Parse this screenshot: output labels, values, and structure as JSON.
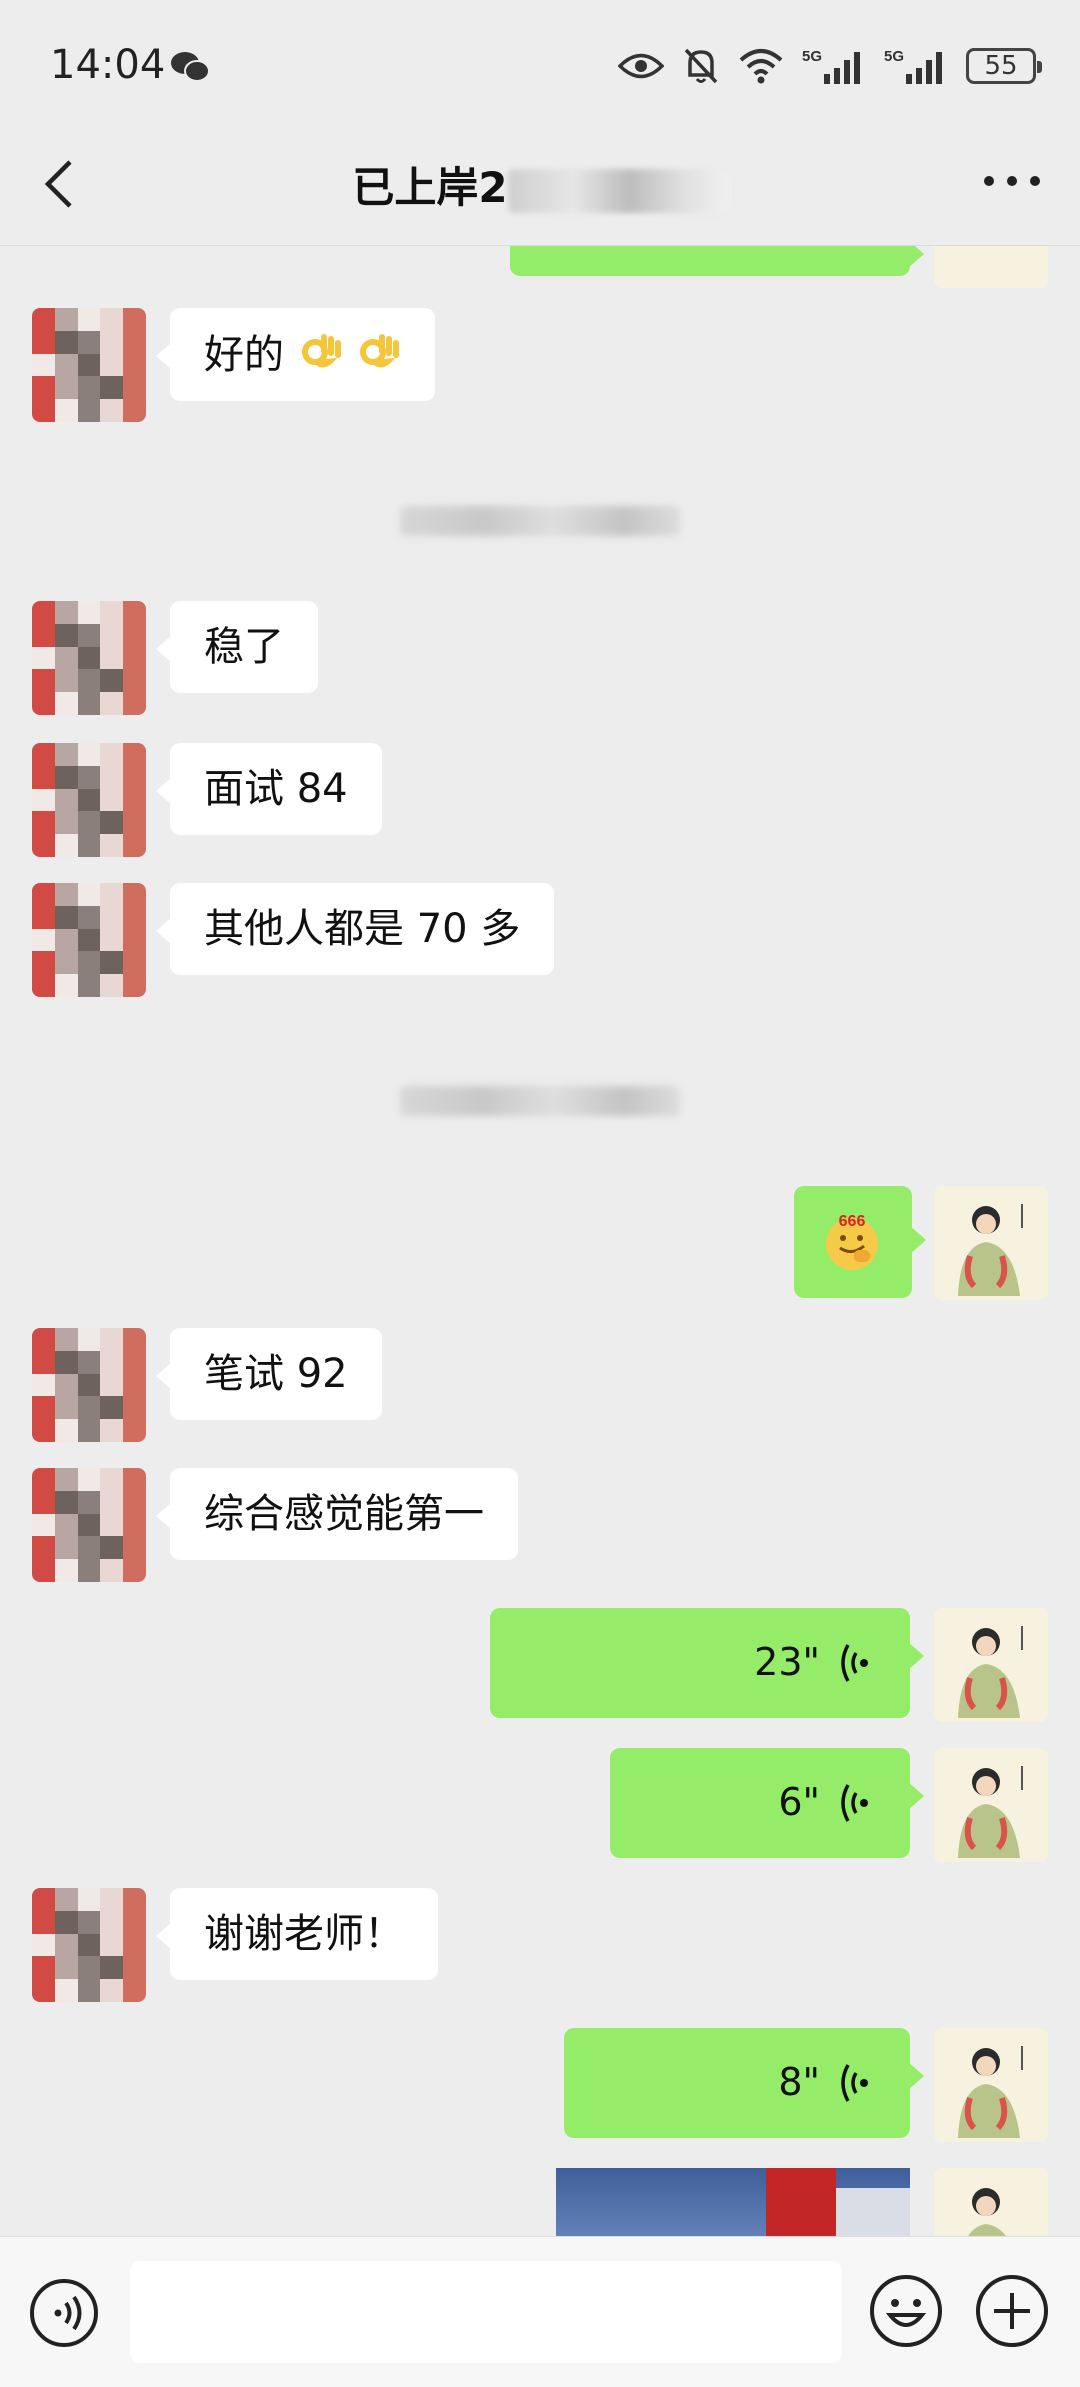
{
  "status_bar": {
    "time": "14:04",
    "battery": "55",
    "network_1": "5G",
    "network_2": "5G"
  },
  "nav": {
    "title": "已上岸2"
  },
  "messages": [
    {
      "side": "in",
      "text": "好的"
    },
    {
      "side": "in",
      "text": "稳了"
    },
    {
      "side": "in",
      "text": "面试 84"
    },
    {
      "side": "in",
      "text": "其他人都是 70 多"
    },
    {
      "side": "out",
      "type": "sticker",
      "text": "666"
    },
    {
      "side": "in",
      "text": "笔试 92"
    },
    {
      "side": "in",
      "text": "综合感觉能第一"
    },
    {
      "side": "out",
      "type": "voice",
      "duration": "23\""
    },
    {
      "side": "out",
      "type": "voice",
      "duration": "6\""
    },
    {
      "side": "in",
      "text": "谢谢老师！"
    },
    {
      "side": "out",
      "type": "voice",
      "duration": "8\""
    }
  ],
  "colors": {
    "background": "#ededed",
    "outgoing_bubble": "#95ec69",
    "incoming_bubble": "#ffffff"
  }
}
